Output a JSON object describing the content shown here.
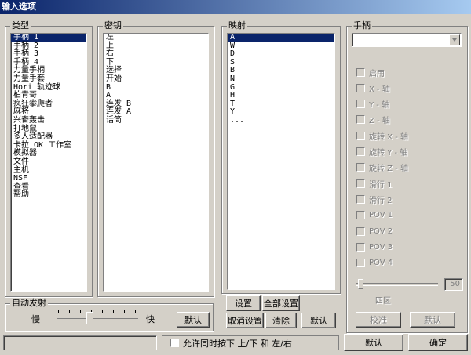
{
  "window": {
    "title": "输入选项"
  },
  "type_group": {
    "label": "类型",
    "items": [
      "手柄 1",
      "手柄 2",
      "手柄 3",
      "手柄 4",
      "力量手柄",
      "力量手套",
      "Hori 轨迹球",
      "柏青哥",
      "疯狂攀爬者",
      "麻将",
      "兴奋轰击",
      "打地鼠",
      "多人适配器",
      "卡拉 OK 工作室",
      "模拟器",
      "文件",
      "主机",
      "NSF",
      "查看",
      "帮助"
    ],
    "selected_index": 0
  },
  "key_group": {
    "label": "密钥",
    "items": [
      "左",
      "上",
      "右",
      "下",
      "选择",
      "开始",
      "B",
      "A",
      "连发 B",
      "连发 A",
      "话筒"
    ]
  },
  "map_group": {
    "label": "映射",
    "items": [
      "A",
      "W",
      "D",
      "S",
      "B",
      "N",
      "G",
      "H",
      "T",
      "Y",
      "..."
    ],
    "selected_index": 0
  },
  "controller_group": {
    "label": "手柄",
    "dropdown_value": "",
    "checkboxes": [
      "启用",
      "X - 轴",
      "Y - 轴",
      "Z - 轴",
      "旋转 X - 轴",
      "旋转 Y - 轴",
      "旋转 Z - 轴",
      "滑行 1",
      "滑行 2",
      "POV 1",
      "POV 2",
      "POV 3",
      "POV 4"
    ],
    "deadzone_label": "四区",
    "deadzone_value": "50",
    "calibrate_label": "校准",
    "default_label": "默认"
  },
  "autofire": {
    "label": "自动发射",
    "slow_label": "慢",
    "fast_label": "快",
    "default_label": "默认",
    "speed_level": 0.38
  },
  "map_buttons": {
    "set": "设置",
    "set_all": "全部设置",
    "cancel_set": "取消设置",
    "clear": "清除",
    "default": "默认"
  },
  "bottom": {
    "status_text": "",
    "allow_simultaneous": "允许同时按下 上/下 和 左/右",
    "default_label": "默认",
    "ok_label": "确定"
  }
}
